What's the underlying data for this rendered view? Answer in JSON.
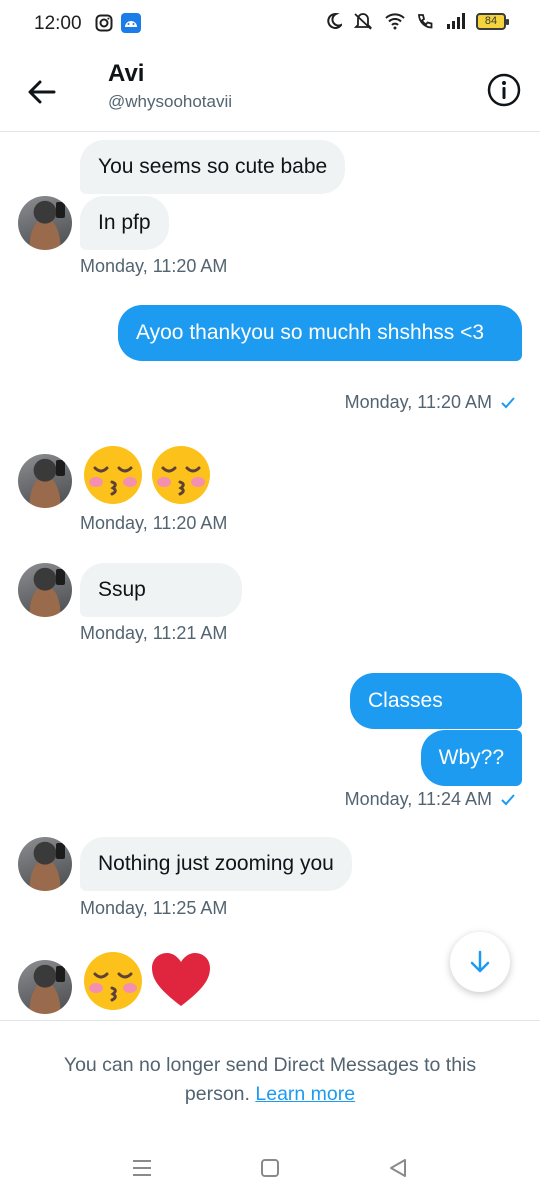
{
  "status_bar": {
    "time": "12:00",
    "left_icons": [
      "instagram-icon",
      "android-icon"
    ],
    "right_icons": [
      "moon-icon",
      "mute-icon",
      "wifi-icon",
      "wifi-call-icon",
      "signal-icon"
    ],
    "battery": "84"
  },
  "header": {
    "name": "Avi",
    "handle": "@whysoohotavii"
  },
  "messages": {
    "m1": "You seems so cute babe",
    "m2": "In pfp",
    "ts1": "Monday, 11:20 AM",
    "m3": "Ayoo thankyou so muchh shshhss <3",
    "ts2": "Monday, 11:20 AM",
    "ts3": "Monday, 11:20 AM",
    "m4": "Ssup",
    "ts4": "Monday, 11:21 AM",
    "m5": "Classes",
    "m6": "Wby??",
    "ts5": "Monday, 11:24 AM",
    "m7": "Nothing just zooming you",
    "ts6": "Monday, 11:25 AM"
  },
  "emojis": [
    "kissing-closed-eyes",
    "kissing-closed-eyes",
    "kissing-closed-eyes",
    "red-heart"
  ],
  "notice": {
    "text": "You can no longer send Direct Messages to this person. ",
    "link": "Learn more"
  },
  "colors": {
    "accent": "#1d9bf0",
    "incoming_bubble": "#eff3f4",
    "muted_text": "#536471"
  }
}
